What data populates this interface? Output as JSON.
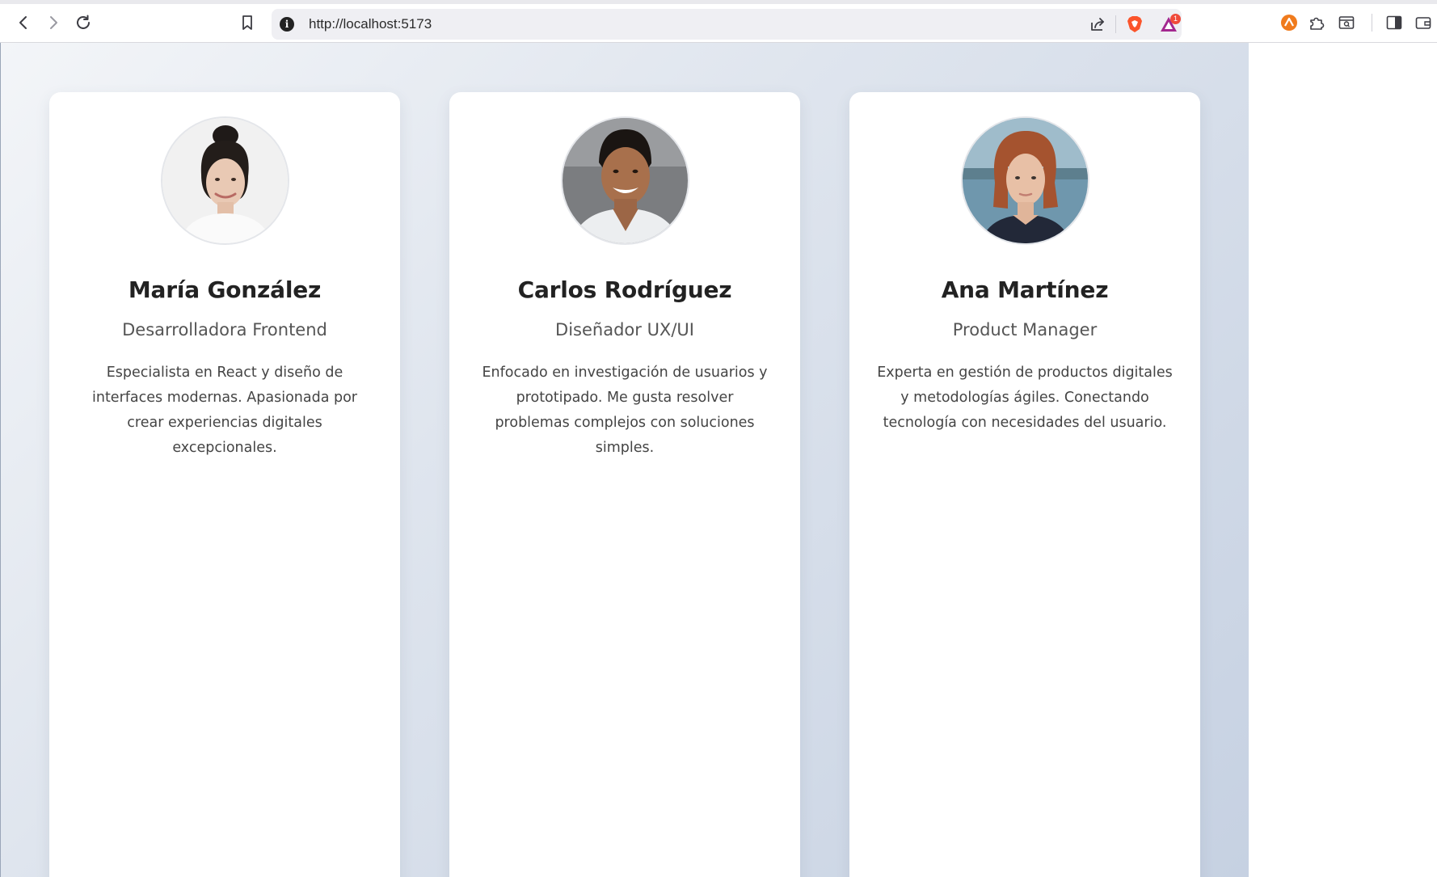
{
  "browser": {
    "url": "http://localhost:5173",
    "notification_count": "1"
  },
  "team": [
    {
      "name": "María González",
      "role": "Desarrolladora Frontend",
      "bio": "Especialista en React y diseño de interfaces modernas. Apasionada por crear experiencias digitales excepcionales."
    },
    {
      "name": "Carlos Rodríguez",
      "role": "Diseñador UX/UI",
      "bio": "Enfocado en investigación de usuarios y prototipado. Me gusta resolver problemas complejos con soluciones simples."
    },
    {
      "name": "Ana Martínez",
      "role": "Product Manager",
      "bio": "Experta en gestión de productos digitales y metodologías ágiles. Conectando tecnología con necesidades del usuario."
    }
  ],
  "colors": {
    "brave": "#fb542b",
    "rewards": "#a3278f",
    "card": "#ffffff"
  }
}
